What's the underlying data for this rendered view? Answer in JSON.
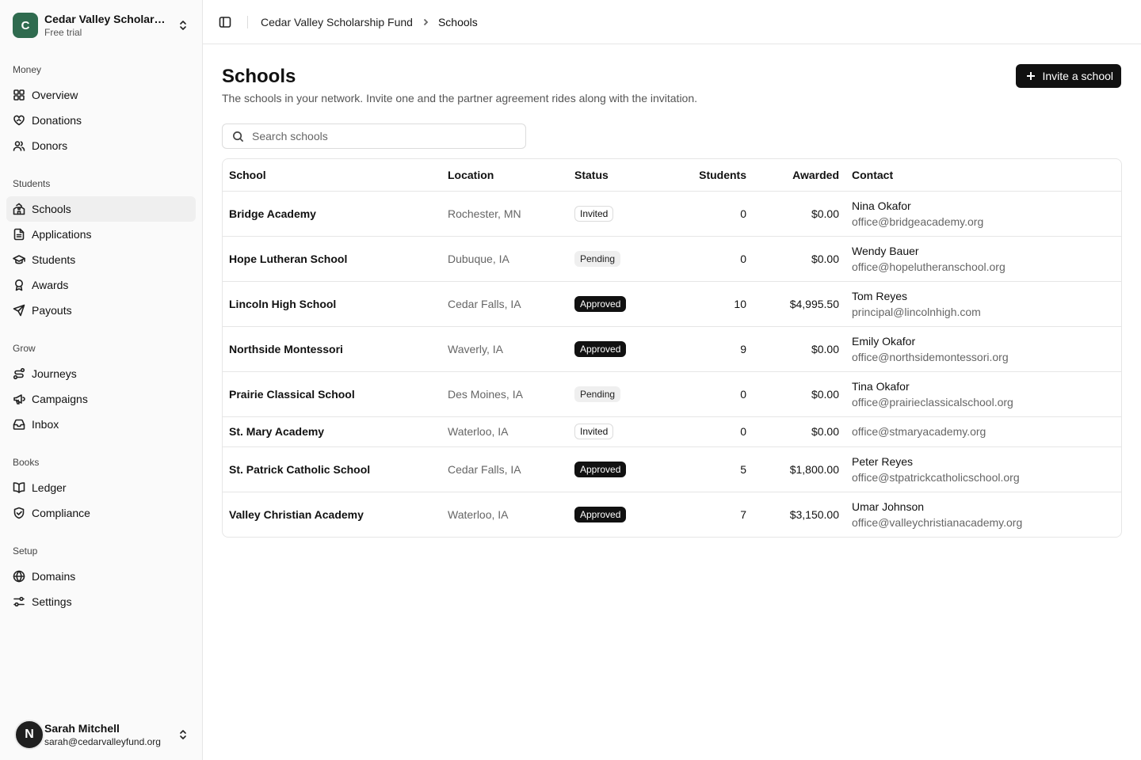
{
  "org": {
    "initial": "C",
    "name": "Cedar Valley Scholarship Fund",
    "plan": "Free trial"
  },
  "nav": {
    "groups": [
      {
        "label": "Money",
        "items": [
          {
            "label": "Overview",
            "icon": "dashboard-icon"
          },
          {
            "label": "Donations",
            "icon": "heart-hand-icon"
          },
          {
            "label": "Donors",
            "icon": "users-icon"
          }
        ]
      },
      {
        "label": "Students",
        "items": [
          {
            "label": "Schools",
            "icon": "school-icon",
            "active": true
          },
          {
            "label": "Applications",
            "icon": "file-text-icon"
          },
          {
            "label": "Students",
            "icon": "graduation-cap-icon"
          },
          {
            "label": "Awards",
            "icon": "award-icon"
          },
          {
            "label": "Payouts",
            "icon": "send-icon"
          }
        ]
      },
      {
        "label": "Grow",
        "items": [
          {
            "label": "Journeys",
            "icon": "route-icon"
          },
          {
            "label": "Campaigns",
            "icon": "megaphone-icon"
          },
          {
            "label": "Inbox",
            "icon": "inbox-icon"
          }
        ]
      },
      {
        "label": "Books",
        "items": [
          {
            "label": "Ledger",
            "icon": "book-icon"
          },
          {
            "label": "Compliance",
            "icon": "shield-check-icon"
          }
        ]
      },
      {
        "label": "Setup",
        "items": [
          {
            "label": "Domains",
            "icon": "globe-icon"
          },
          {
            "label": "Settings",
            "icon": "sliders-icon"
          }
        ]
      }
    ]
  },
  "user": {
    "initial": "N",
    "name": "Sarah Mitchell",
    "email": "sarah@cedarvalleyfund.org"
  },
  "breadcrumb": {
    "parent": "Cedar Valley Scholarship Fund",
    "current": "Schools"
  },
  "page": {
    "title": "Schools",
    "subtitle": "The schools in your network. Invite one and the partner agreement rides along with the invitation.",
    "invite_label": "Invite a school",
    "search_placeholder": "Search schools"
  },
  "table": {
    "columns": {
      "school": "School",
      "location": "Location",
      "status": "Status",
      "students": "Students",
      "awarded": "Awarded",
      "contact": "Contact"
    },
    "rows": [
      {
        "school": "Bridge Academy",
        "location": "Rochester, MN",
        "status": "Invited",
        "students": "0",
        "awarded": "$0.00",
        "contact_name": "Nina Okafor",
        "contact_email": "office@bridgeacademy.org"
      },
      {
        "school": "Hope Lutheran School",
        "location": "Dubuque, IA",
        "status": "Pending",
        "students": "0",
        "awarded": "$0.00",
        "contact_name": "Wendy Bauer",
        "contact_email": "office@hopelutheranschool.org"
      },
      {
        "school": "Lincoln High School",
        "location": "Cedar Falls, IA",
        "status": "Approved",
        "students": "10",
        "awarded": "$4,995.50",
        "contact_name": "Tom Reyes",
        "contact_email": "principal@lincolnhigh.com"
      },
      {
        "school": "Northside Montessori",
        "location": "Waverly, IA",
        "status": "Approved",
        "students": "9",
        "awarded": "$0.00",
        "contact_name": "Emily Okafor",
        "contact_email": "office@northsidemontessori.org"
      },
      {
        "school": "Prairie Classical School",
        "location": "Des Moines, IA",
        "status": "Pending",
        "students": "0",
        "awarded": "$0.00",
        "contact_name": "Tina Okafor",
        "contact_email": "office@prairieclassicalschool.org"
      },
      {
        "school": "St. Mary Academy",
        "location": "Waterloo, IA",
        "status": "Invited",
        "students": "0",
        "awarded": "$0.00",
        "contact_name": "",
        "contact_email": "office@stmaryacademy.org"
      },
      {
        "school": "St. Patrick Catholic School",
        "location": "Cedar Falls, IA",
        "status": "Approved",
        "students": "5",
        "awarded": "$1,800.00",
        "contact_name": "Peter Reyes",
        "contact_email": "office@stpatrickcatholicschool.org"
      },
      {
        "school": "Valley Christian Academy",
        "location": "Waterloo, IA",
        "status": "Approved",
        "students": "7",
        "awarded": "$3,150.00",
        "contact_name": "Umar Johnson",
        "contact_email": "office@valleychristianacademy.org"
      }
    ]
  }
}
